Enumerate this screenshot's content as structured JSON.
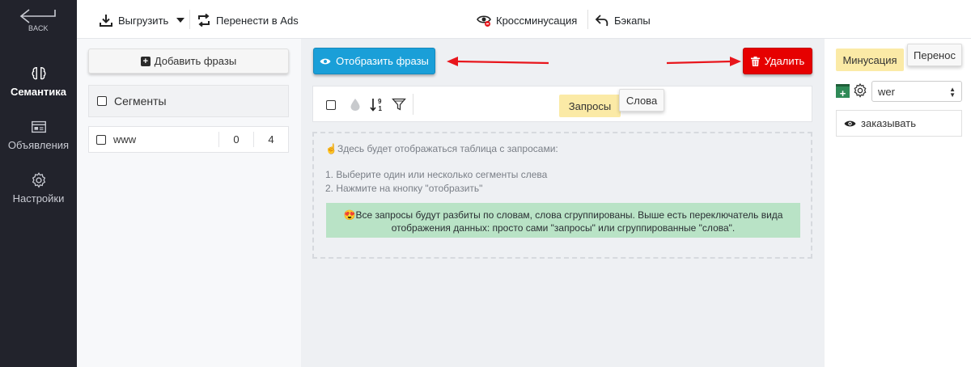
{
  "nav": {
    "back_label": "BACK",
    "items": [
      {
        "label": "Семантика",
        "icon": "brain-icon",
        "active": true
      },
      {
        "label": "Объявления",
        "icon": "ad-icon",
        "active": false
      },
      {
        "label": "Настройки",
        "icon": "gear-icon",
        "active": false
      }
    ]
  },
  "toolbar": {
    "export_label": "Выгрузить",
    "transfer_label": "Перенести в Ads",
    "crossminus_label": "Кроссминусация",
    "backups_label": "Бэкапы"
  },
  "segments": {
    "add_button_label": "Добавить фразы",
    "header_label": "Сегменты",
    "rows": [
      {
        "name": "www",
        "count_a": "0",
        "count_b": "4"
      }
    ]
  },
  "center": {
    "show_button_label": "Отобразить фразы",
    "delete_button_label": "Удалить",
    "tab_requests_label": "Запросы",
    "tab_words_label": "Слова",
    "info_line1": "☝Здесь будет отображаться таблица с запросами:",
    "info_line2": "1. Выберите один или несколько сегменты слева",
    "info_line3": "2. Нажмите на кнопку \"отобразить\"",
    "note": "😍Все запросы будут разбиты по словам, слова сгруппированы. Выше есть переключатель вида отображения данных: просто сами \"запросы\" или сгруппированные \"слова\"."
  },
  "right": {
    "tab_minus_label": "Минусация",
    "tab_move_label": "Перенос",
    "select_value": "wer",
    "minus_words": [
      {
        "label": "заказывать"
      }
    ]
  },
  "colors": {
    "sidebar_bg": "#22232c",
    "primary_blue": "#1a9fd8",
    "danger_red": "#e60000",
    "active_tab_yellow": "#fbeaa6",
    "note_green": "#b9e3c6",
    "arrow_red": "#e8161c"
  }
}
